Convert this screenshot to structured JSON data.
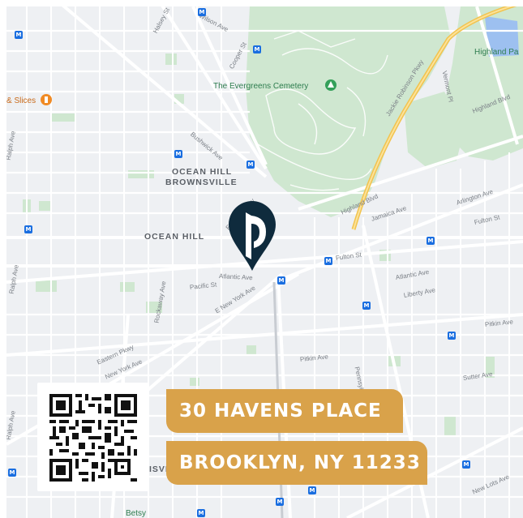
{
  "map": {
    "neighborhoods": {
      "ocean_hill_brownsville_1": "OCEAN HILL",
      "ocean_hill_brownsville_2": "BROWNSVILLE",
      "ocean_hill": "OCEAN HILL"
    },
    "pois": {
      "cemetery": "The Evergreens Cemetery",
      "slices": "& Slices",
      "highland_park": "Highland Pa",
      "betsy": "Betsy",
      "brownsville_partial": "ISVI"
    },
    "streets": {
      "wilson": "Wilson Ave",
      "halsey": "Halsey St",
      "cooper": "Cooper St",
      "bushwick": "Bushwick Ave",
      "ralph_top": "Ralph Ave",
      "eastern_top": "Eastern Pkwy",
      "highland_blvd_left": "Highland Blvd",
      "jamaica": "Jamaica Ave",
      "arlington": "Arlington Ave",
      "fulton_right": "Fulton St",
      "jackie": "Jackie Robinson Pkwy",
      "vermont": "Vermont Pl",
      "highland_blvd_right": "Highland Blvd",
      "fulton": "Fulton St",
      "atlantic_left": "Atlantic Ave",
      "atlantic_right": "Atlantic Ave",
      "pacific": "Pacific St",
      "liberty": "Liberty Ave",
      "ralph_mid": "Ralph Ave",
      "rockaway": "Rockaway Ave",
      "e_new_york": "E New York Ave",
      "eastern_bottom": "Eastern Pkwy",
      "new_york": "New York Ave",
      "pitkin_mid": "Pitkin Ave",
      "pitkin_right": "Pitkin Ave",
      "pennsylvania": "Pennsylvania Ave",
      "sutter": "Sutter Ave",
      "new_lots": "New Lots Ave",
      "ralph_bottom": "Ralph Ave"
    },
    "transit_badge": "M"
  },
  "pin": {
    "color": "#0f2b3d",
    "icon": "location-pin-logo-icon"
  },
  "qr": {
    "icon": "qr-code-icon"
  },
  "address": {
    "line1": "30 HAVENS PLACE",
    "line2": "BROOKLYN, NY 11233",
    "accent": "#d9a24a"
  }
}
